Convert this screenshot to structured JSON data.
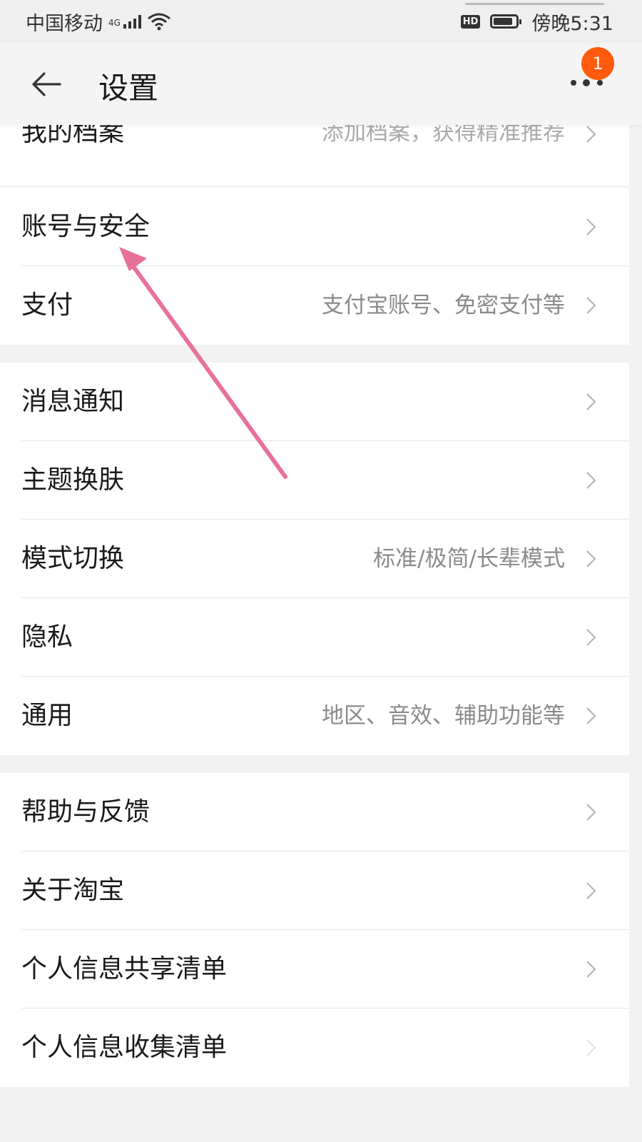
{
  "status_bar": {
    "carrier": "中国移动",
    "network": "4G",
    "hd": "HD",
    "time": "傍晚5:31"
  },
  "header": {
    "title": "设置",
    "badge_count": "1"
  },
  "partial_item": {
    "label": "我的档案",
    "sub": "添加档案，获得精准推荐"
  },
  "groups": [
    {
      "items": [
        {
          "label": "账号与安全",
          "sub": ""
        },
        {
          "label": "支付",
          "sub": "支付宝账号、免密支付等"
        }
      ]
    },
    {
      "items": [
        {
          "label": "消息通知",
          "sub": ""
        },
        {
          "label": "主题换肤",
          "sub": ""
        },
        {
          "label": "模式切换",
          "sub": "标准/极简/长辈模式"
        },
        {
          "label": "隐私",
          "sub": ""
        },
        {
          "label": "通用",
          "sub": "地区、音效、辅助功能等"
        }
      ]
    },
    {
      "items": [
        {
          "label": "帮助与反馈",
          "sub": ""
        },
        {
          "label": "关于淘宝",
          "sub": ""
        },
        {
          "label": "个人信息共享清单",
          "sub": ""
        },
        {
          "label": "个人信息收集清单",
          "sub": ""
        }
      ]
    }
  ],
  "colors": {
    "badge": "#ff5a0d",
    "annotation_arrow": "#e8719a",
    "background": "#f2f2f2"
  }
}
